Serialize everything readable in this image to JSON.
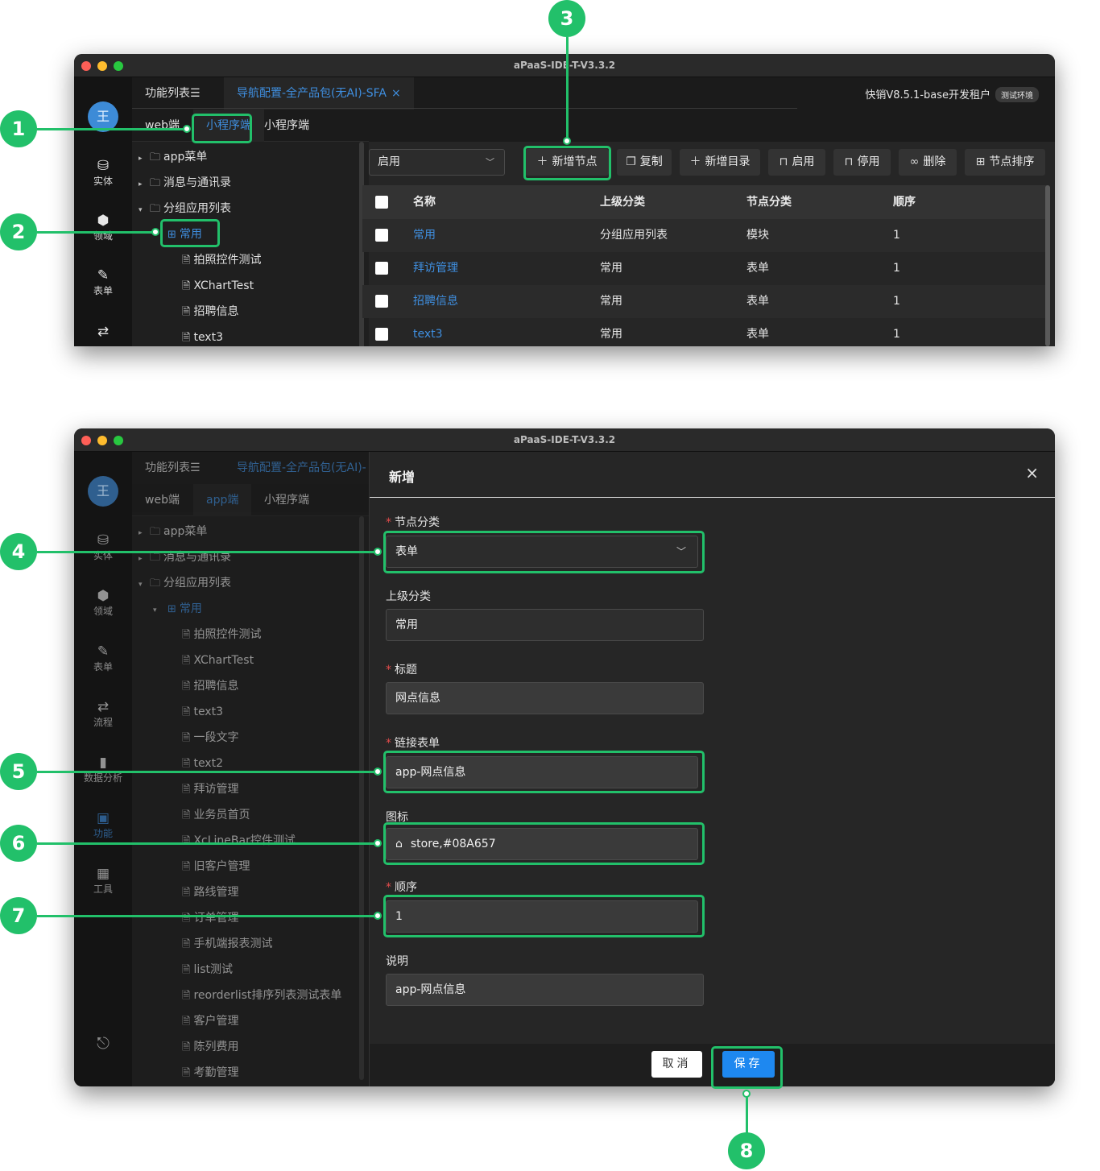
{
  "window": {
    "title": "aPaaS-IDE-T-V3.3.2"
  },
  "rail": {
    "avatar": "王",
    "items": [
      {
        "label": "实体",
        "icon": "database-icon"
      },
      {
        "label": "领域",
        "icon": "cube-icon"
      },
      {
        "label": "表单",
        "icon": "form-icon"
      },
      {
        "label": "流程",
        "icon": "flow-icon"
      },
      {
        "label": "数据分析",
        "icon": "bar-chart-icon"
      },
      {
        "label": "功能",
        "icon": "function-icon"
      },
      {
        "label": "工具",
        "icon": "grid-icon"
      }
    ],
    "logout_icon": "logout-icon"
  },
  "tabs": {
    "func_list": "功能列表☰",
    "nav_config": "导航配置-全产品包(无AI)-SFA",
    "nav_config_short": "导航配置-全产品包(无AI)-",
    "close": "×"
  },
  "tenant": {
    "name": "快销V8.5.1-base开发租户",
    "env": "测试环境"
  },
  "subtabs": [
    "web端",
    "app端",
    "小程序端"
  ],
  "tree1": [
    "app菜单",
    "消息与通讯录",
    "分组应用列表",
    "常用",
    "拍照控件测试",
    "XChartTest",
    "招聘信息",
    "text3"
  ],
  "tree2": [
    "app菜单",
    "消息与通讯录",
    "分组应用列表",
    "常用",
    "拍照控件测试",
    "XChartTest",
    "招聘信息",
    "text3",
    "一段文字",
    "text2",
    "拜访管理",
    "业务员首页",
    "XcLineBar控件测试",
    "旧客户管理",
    "路线管理",
    "订单管理",
    "手机端报表测试",
    "list测试",
    "reorderlist排序列表测试表单",
    "客户管理",
    "陈列费用",
    "考勤管理"
  ],
  "toolbar": {
    "status": "启用",
    "buttons": [
      "新增节点",
      "复制",
      "新增目录",
      "启用",
      "停用",
      "删除",
      "节点排序"
    ]
  },
  "table": {
    "headers": [
      "名称",
      "上级分类",
      "节点分类",
      "顺序"
    ],
    "rows": [
      [
        "常用",
        "分组应用列表",
        "模块",
        "1"
      ],
      [
        "拜访管理",
        "常用",
        "表单",
        "1"
      ],
      [
        "招聘信息",
        "常用",
        "表单",
        "1"
      ],
      [
        "text3",
        "常用",
        "表单",
        "1"
      ]
    ]
  },
  "drawer": {
    "title": "新增",
    "close": "×",
    "fields": {
      "node_type": {
        "label": "节点分类",
        "value": "表单"
      },
      "parent": {
        "label": "上级分类",
        "value": "常用"
      },
      "title": {
        "label": "标题",
        "value": "网点信息"
      },
      "link_form": {
        "label": "链接表单",
        "value": "app-网点信息"
      },
      "icon": {
        "label": "图标",
        "value": "store,#08A657"
      },
      "order": {
        "label": "顺序",
        "value": "1"
      },
      "desc": {
        "label": "说明",
        "value": "app-网点信息"
      }
    },
    "cancel": "取消",
    "save": "保存"
  },
  "callouts": [
    "1",
    "2",
    "3",
    "4",
    "5",
    "6",
    "7",
    "8"
  ],
  "colors": {
    "accent": "#3f8fe0",
    "callout": "#22c06a",
    "required": "#e34c4c",
    "save": "#1e88f0"
  }
}
